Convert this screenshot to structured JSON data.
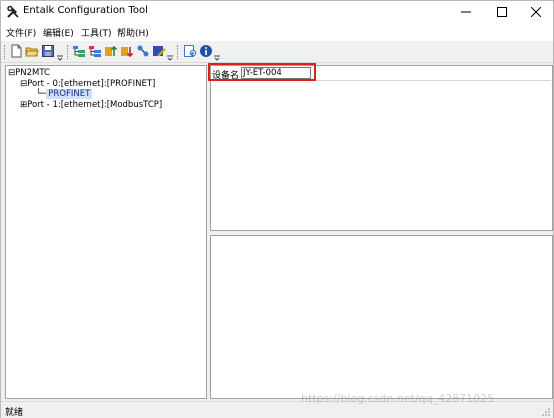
{
  "window": {
    "title": "Entalk Configuration Tool"
  },
  "menu": {
    "items": [
      "文件(F)",
      "编辑(E)",
      "工具(T)",
      "帮助(H)"
    ]
  },
  "toolbar": {
    "icons": [
      "new-file-icon",
      "open-folder-icon",
      "save-icon",
      "tree-view-icon",
      "add-device-icon",
      "upload-icon",
      "download-icon",
      "connect-icon",
      "edit-icon",
      "refresh-icon",
      "info-icon"
    ]
  },
  "tree": {
    "root": "PN2MTC",
    "port0": "Port - 0:[ethernet]:[PROFINET]",
    "port0_child": "PROFINET",
    "port1": "Port - 1:[ethernet]:[ModbusTCP]",
    "expand_open": "⊟",
    "expand_closed": "⊞"
  },
  "properties": {
    "device_name_label": "设备名",
    "device_name_value": "JY-ET-004"
  },
  "status": {
    "text": "就绪"
  },
  "watermark": "https://blog.csdn.net/qq_42871025",
  "colors": {
    "highlight": "#d92020",
    "selection": "#cfe0ff"
  }
}
